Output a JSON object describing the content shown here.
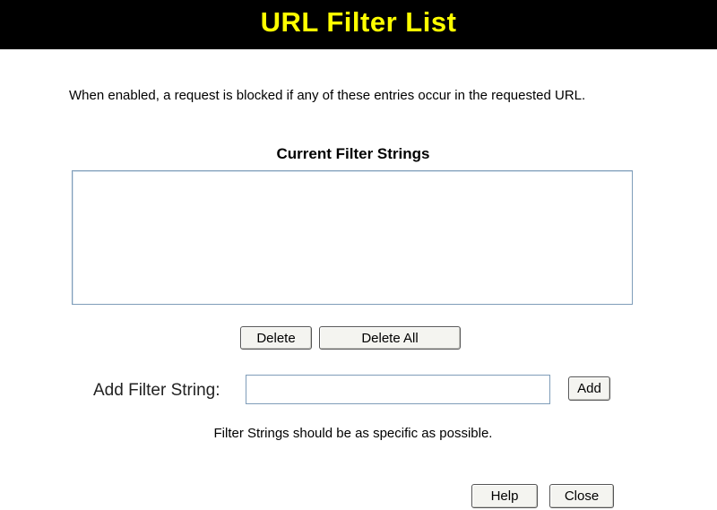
{
  "header": {
    "title": "URL Filter List",
    "title_color": "#ffff00",
    "background_color": "#000000"
  },
  "intro_text": "When enabled, a request is blocked if any of these entries occur in the requested URL.",
  "filter_list": {
    "heading": "Current Filter Strings",
    "entries": []
  },
  "list_actions": {
    "delete_label": "Delete",
    "delete_all_label": "Delete All"
  },
  "add_filter": {
    "label": "Add Filter String:",
    "value": "",
    "button_label": "Add"
  },
  "hint_text": "Filter Strings should be as specific as possible.",
  "footer": {
    "help_label": "Help",
    "close_label": "Close"
  }
}
